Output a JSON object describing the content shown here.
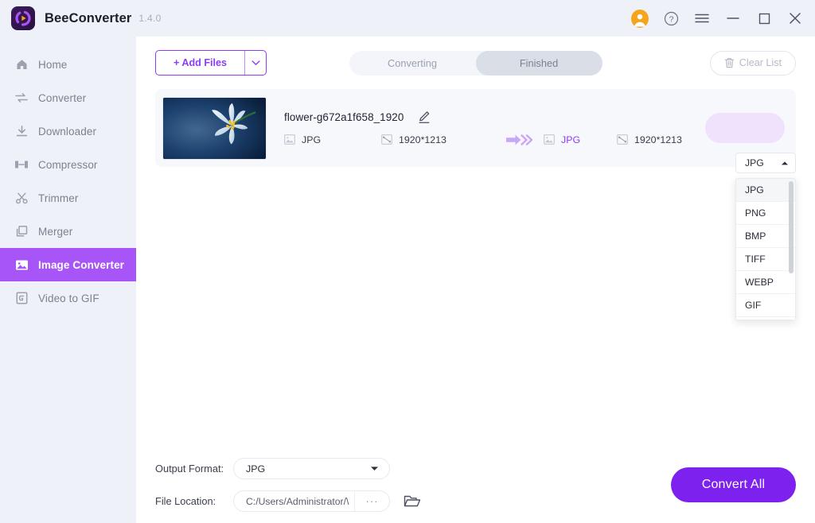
{
  "titlebar": {
    "app_name": "BeeConverter",
    "version": "1.4.0",
    "logo_icon": "bee-converter-logo-icon",
    "account_icon": "account-avatar-icon",
    "help_icon": "help-circle-icon",
    "menu_icon": "hamburger-menu-icon",
    "minimize_icon": "minimize-icon",
    "maximize_icon": "maximize-icon",
    "close_icon": "close-icon"
  },
  "sidebar": {
    "items": [
      {
        "label": "Home",
        "icon": "home-icon",
        "active": false
      },
      {
        "label": "Converter",
        "icon": "convert-arrows-icon",
        "active": false
      },
      {
        "label": "Downloader",
        "icon": "download-icon",
        "active": false
      },
      {
        "label": "Compressor",
        "icon": "compress-icon",
        "active": false
      },
      {
        "label": "Trimmer",
        "icon": "scissors-icon",
        "active": false
      },
      {
        "label": "Merger",
        "icon": "merge-layers-icon",
        "active": false
      },
      {
        "label": "Image Converter",
        "icon": "image-icon",
        "active": true
      },
      {
        "label": "Video to GIF",
        "icon": "gif-icon",
        "active": false
      }
    ]
  },
  "toolbar": {
    "add_files_label": "+ Add Files",
    "add_files_caret_icon": "chevron-down-icon",
    "tabs": [
      {
        "label": "Converting",
        "active": false
      },
      {
        "label": "Finished",
        "active": true
      }
    ],
    "clear_list_label": "Clear List",
    "clear_list_icon": "trash-icon"
  },
  "file_row": {
    "thumbnail_alt": "white-lily-flower-thumbnail",
    "file_name": "flower-g672a1f658_1920",
    "edit_icon": "pencil-edit-icon",
    "source_format": "JPG",
    "source_format_icon": "image-file-icon",
    "source_dimensions": "1920*1213",
    "source_dimensions_icon": "resize-icon",
    "arrow_icon": "double-arrow-right-icon",
    "target_format": "JPG",
    "target_format_icon": "image-file-icon",
    "target_dimensions": "1920*1213",
    "target_dimensions_icon": "resize-icon"
  },
  "format_dropdown": {
    "selected": "JPG",
    "caret_icon": "chevron-up-icon",
    "open": true,
    "options": [
      "JPG",
      "PNG",
      "BMP",
      "TIFF",
      "WEBP",
      "GIF"
    ]
  },
  "bottombar": {
    "output_format_label": "Output Format:",
    "output_format_value": "JPG",
    "output_format_caret_icon": "chevron-down-icon",
    "file_location_label": "File Location:",
    "file_location_value": "C:/Users/Administrator/\\",
    "browse_dots_label": "···",
    "folder_icon": "folder-open-icon",
    "convert_all_label": "Convert All"
  },
  "colors": {
    "accent_purple": "#7d21ef",
    "sidebar_active": "#a855f7",
    "titlebar_bg": "#eef1f8",
    "card_bg": "#f7f8fc",
    "avatar_orange": "#f7a41d"
  }
}
